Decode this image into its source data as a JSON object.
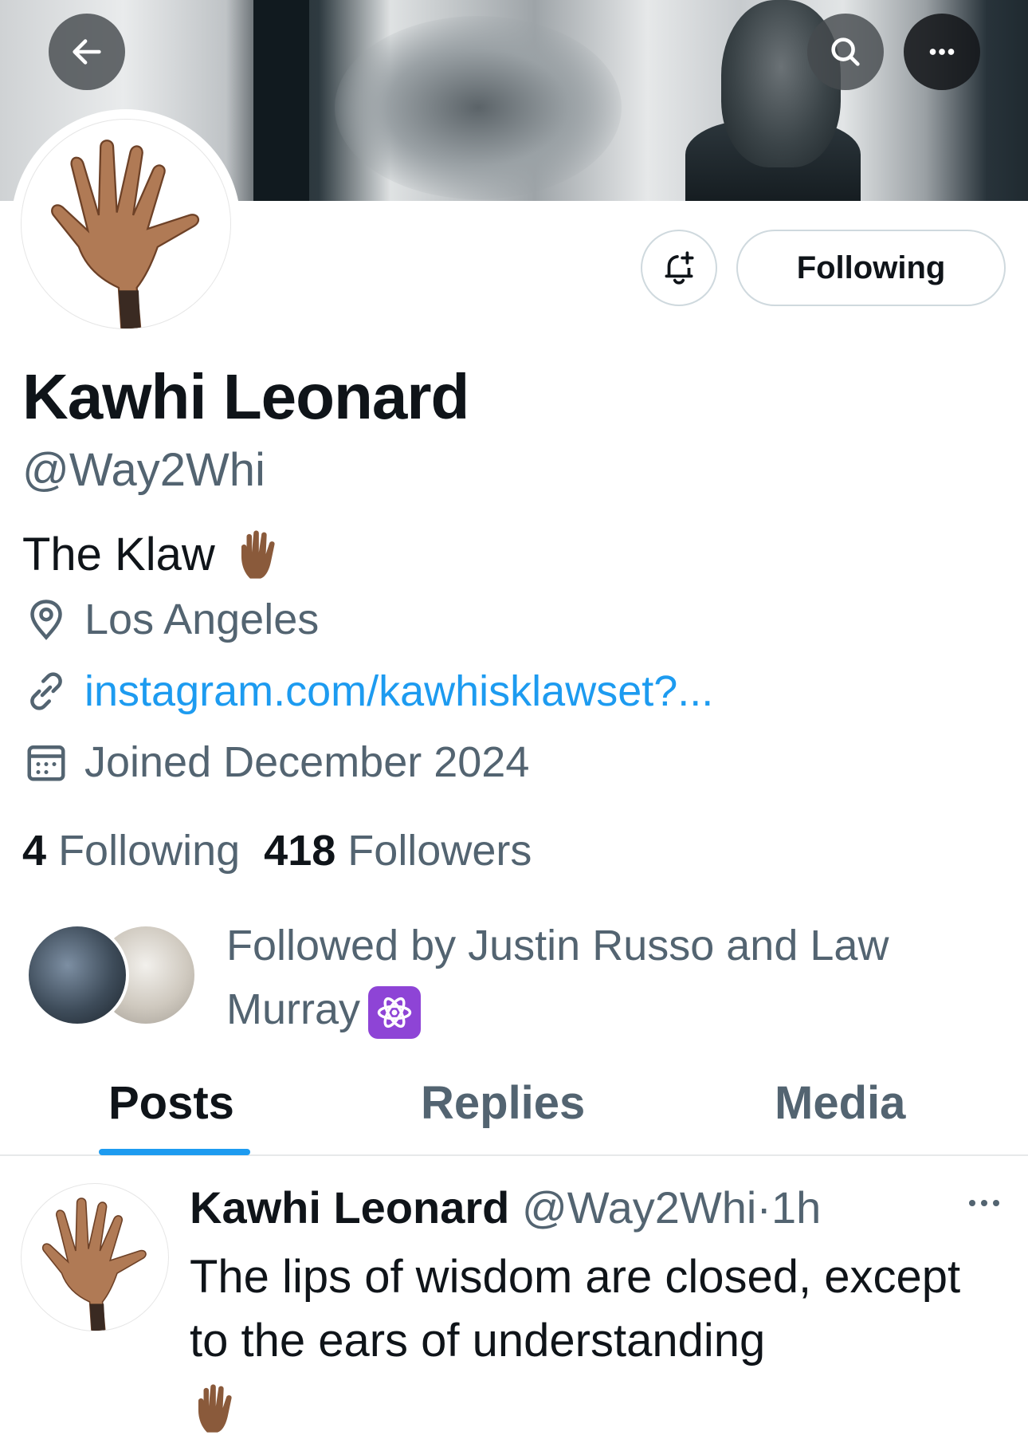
{
  "header": {
    "back_icon": "arrow-left-icon",
    "search_icon": "search-icon",
    "more_icon": "more-horizontal-icon"
  },
  "profile": {
    "name": "Kawhi Leonard",
    "handle": "@Way2Whi",
    "bio": "The Klaw",
    "bio_emoji": "raised-hand-icon",
    "location": "Los Angeles",
    "website": "instagram.com/kawhisklawset?...",
    "joined": "Joined December 2024",
    "following_count": "4",
    "following_label": "Following",
    "followers_count": "418",
    "followers_label": "Followers"
  },
  "actions": {
    "notify_icon": "bell-plus-icon",
    "following_button": "Following"
  },
  "followed_by": {
    "line1": "Followed by Justin Russo and Law",
    "line2": "Murray",
    "emoji": "atom-symbol-icon"
  },
  "tabs": [
    {
      "label": "Posts",
      "active": true
    },
    {
      "label": "Replies",
      "active": false
    },
    {
      "label": "Media",
      "active": false
    }
  ],
  "post": {
    "author_name": "Kawhi Leonard",
    "author_handle": "@Way2Whi",
    "separator": "·",
    "time": "1h",
    "text": "The lips of wisdom are closed, except to the ears of understanding",
    "emoji": "raised-hand-icon"
  },
  "colors": {
    "accent": "#1d9bf0",
    "text_primary": "#0f1419",
    "text_secondary": "#536471",
    "border": "#cfd9de"
  }
}
